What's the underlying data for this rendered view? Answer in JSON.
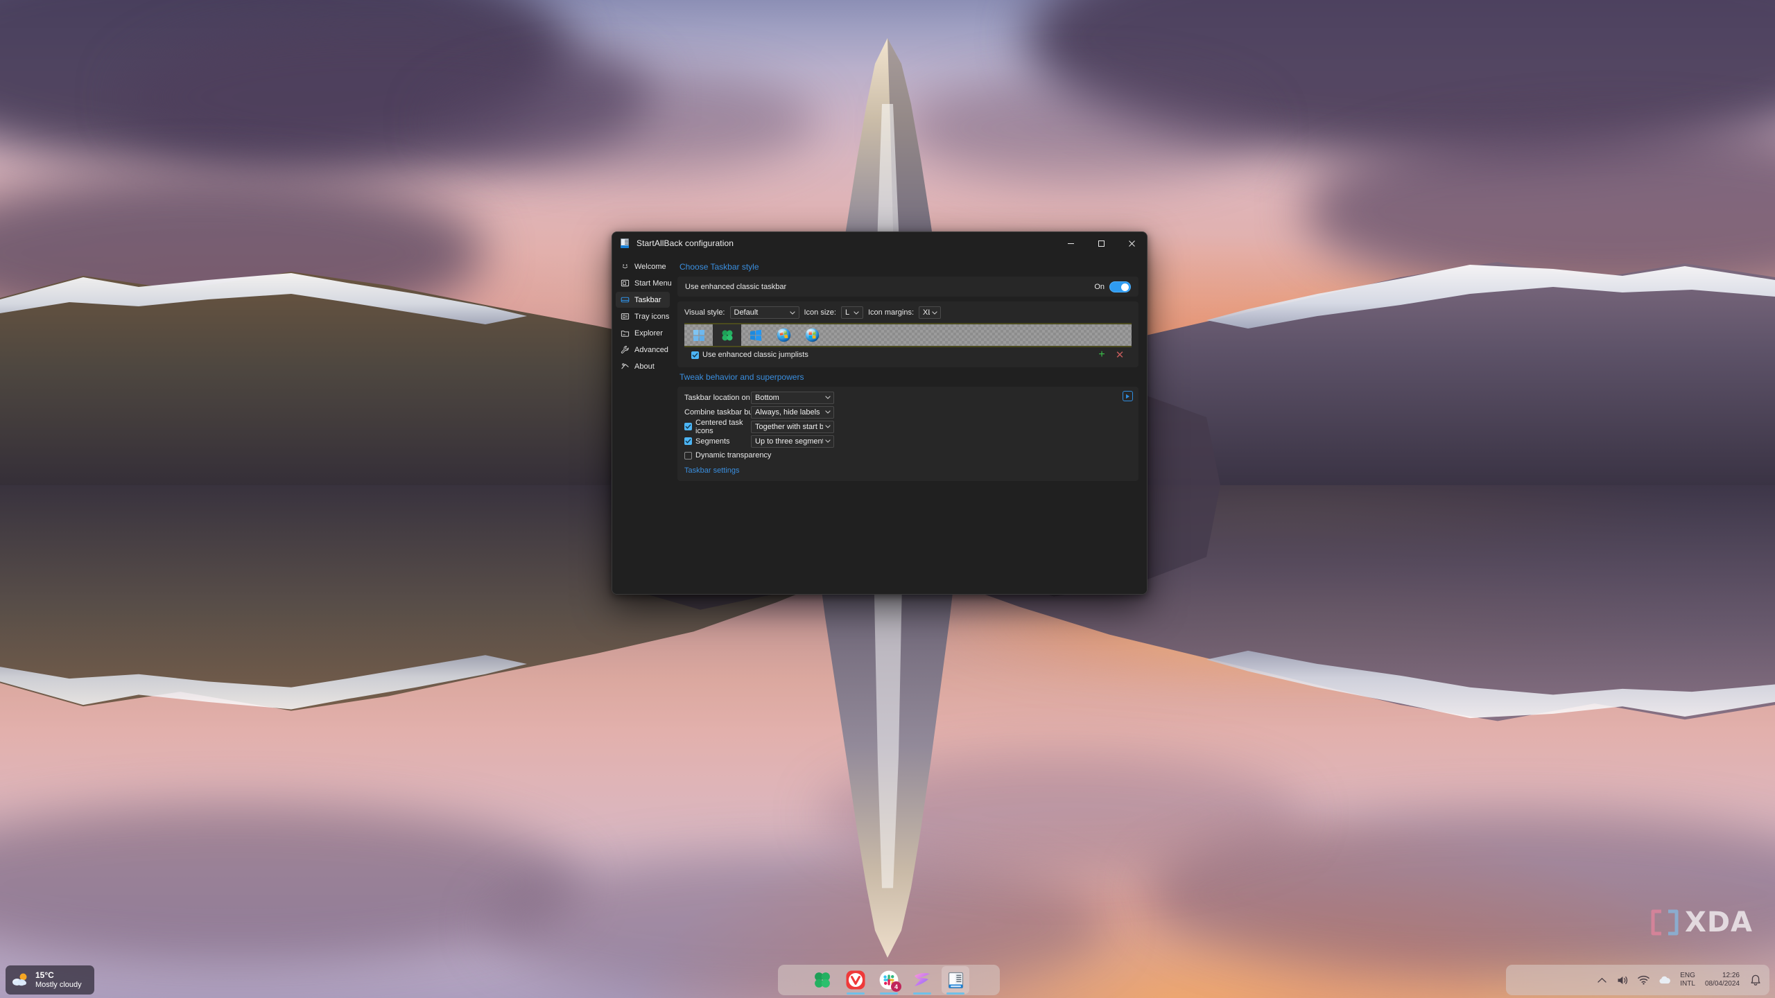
{
  "window": {
    "title": "StartAllBack configuration",
    "icon": "startallback-icon",
    "controls": {
      "minimize": "minimize-icon",
      "maximize": "maximize-icon",
      "close": "close-icon"
    }
  },
  "sidebar": {
    "items": [
      {
        "label": "Welcome",
        "icon": "smiley-icon",
        "active": false
      },
      {
        "label": "Start Menu",
        "icon": "startmenu-icon",
        "active": false
      },
      {
        "label": "Taskbar",
        "icon": "taskbar-icon",
        "active": true
      },
      {
        "label": "Tray icons",
        "icon": "tray-icon",
        "active": false
      },
      {
        "label": "Explorer",
        "icon": "folder-icon",
        "active": false
      },
      {
        "label": "Advanced",
        "icon": "wrench-icon",
        "active": false
      },
      {
        "label": "About",
        "icon": "info-icon",
        "active": false
      }
    ]
  },
  "main": {
    "section_taskbar_style": {
      "heading": "Choose Taskbar style",
      "enhanced_toggle": {
        "label": "Use enhanced classic taskbar",
        "state_label": "On",
        "state": true
      },
      "fields": [
        {
          "label": "Visual style:",
          "value": "Default",
          "width": "visual"
        },
        {
          "label": "Icon size:",
          "value": "L",
          "width": "small"
        },
        {
          "label": "Icon margins:",
          "value": "XL",
          "width": "small"
        }
      ],
      "start_button_gallery": [
        {
          "name": "win11-light-logo",
          "selected": false
        },
        {
          "name": "green-clover-logo",
          "selected": true
        },
        {
          "name": "win10-blue-logo",
          "selected": false
        },
        {
          "name": "win7-orb-logo",
          "selected": false
        },
        {
          "name": "vista-orb-logo",
          "selected": false
        }
      ],
      "jumplists": {
        "label": "Use enhanced classic jumplists",
        "checked": true,
        "add_icon": "plus-icon",
        "remove_icon": "cross-icon"
      }
    },
    "section_tweak": {
      "heading": "Tweak behavior and superpowers",
      "play_icon": "play-preview-icon",
      "rows": [
        {
          "type": "combo",
          "label": "Taskbar location on screen:",
          "value": "Bottom"
        },
        {
          "type": "combo",
          "label": "Combine taskbar buttons:",
          "value": "Always, hide labels"
        },
        {
          "type": "checkbox_combo",
          "label": "Centered task icons",
          "value": "Together with start button",
          "checked": true
        },
        {
          "type": "checkbox_combo",
          "label": "Segments",
          "value": "Up to three segments",
          "checked": true
        },
        {
          "type": "checkbox",
          "label": "Dynamic transparency",
          "checked": false
        }
      ],
      "link": "Taskbar settings"
    }
  },
  "desktop": {
    "weather": {
      "temperature": "15°C",
      "condition": "Mostly cloudy",
      "icon": "sun-behind-cloud-icon"
    },
    "watermark": {
      "text": "XDA",
      "bracket_left_color": "#e06c8a",
      "bracket_right_color": "#7fb4de"
    }
  },
  "taskbar": {
    "apps": [
      {
        "name": "start-clover-button",
        "running": false,
        "badge": null
      },
      {
        "name": "vivaldi-app",
        "running": true,
        "badge": null
      },
      {
        "name": "slack-app",
        "running": true,
        "badge": "4"
      },
      {
        "name": "design-app",
        "running": true,
        "badge": null
      },
      {
        "name": "startallback-app",
        "running": true,
        "badge": null
      }
    ],
    "tray": {
      "icons": [
        "chevron-up-icon",
        "volume-icon",
        "wifi-icon",
        "onedrive-cloud-icon"
      ],
      "language_primary": "ENG",
      "language_secondary": "INTL",
      "time": "12:26",
      "date": "08/04/2024",
      "notification_icon": "bell-icon"
    }
  },
  "colors": {
    "accent_blue": "#3a8ede",
    "toggle_on": "#2f9bf0",
    "window_bg": "#202020",
    "card_bg": "#272727",
    "add_green": "#3ac04a",
    "remove_red": "#c05a5a",
    "badge_red": "#c0255a"
  }
}
